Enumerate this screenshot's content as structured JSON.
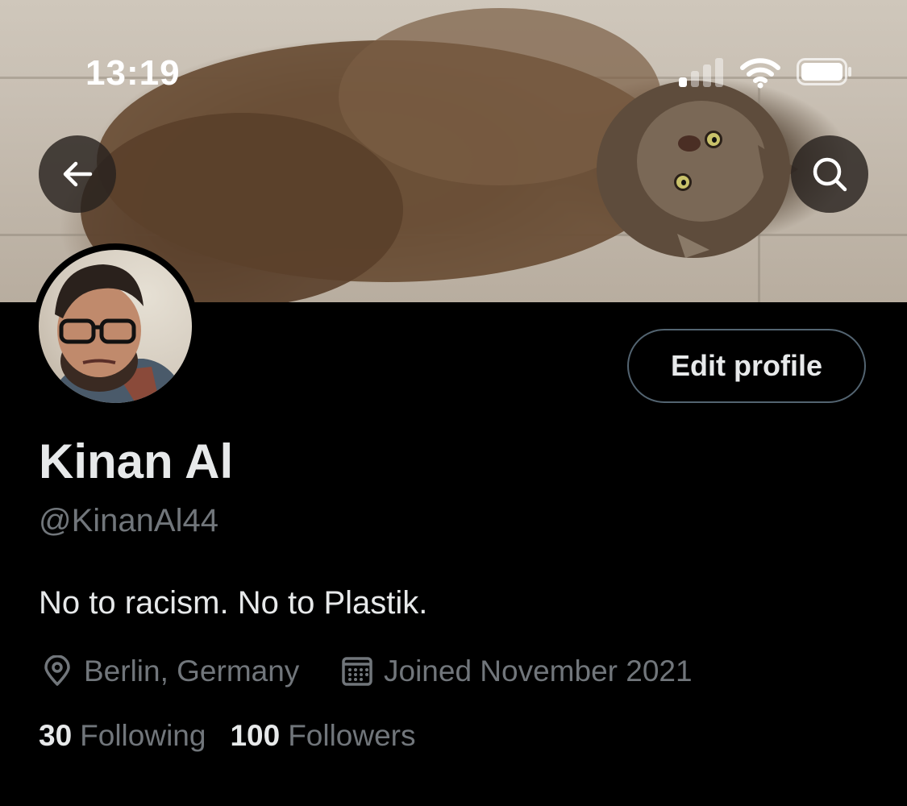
{
  "status_bar": {
    "time": "13:19",
    "signal_bars": 4,
    "signal_active": 1,
    "icons": [
      "signal-icon",
      "wifi-icon",
      "battery-icon"
    ]
  },
  "nav": {
    "back_icon": "arrow-left-icon",
    "search_icon": "search-icon"
  },
  "profile": {
    "name": "Kinan Al",
    "handle": "@KinanAl44",
    "bio": "No to racism. No to Plastik.",
    "location": "Berlin, Germany",
    "location_icon": "location-pin-icon",
    "joined": "Joined November 2021",
    "joined_icon": "calendar-icon",
    "following_count": "30",
    "following_label": "Following",
    "followers_count": "100",
    "followers_label": "Followers"
  },
  "actions": {
    "edit_profile_label": "Edit profile"
  },
  "colors": {
    "background": "#000000",
    "text_primary": "#e7e9ea",
    "text_secondary": "#71767b",
    "button_border": "#536471"
  }
}
